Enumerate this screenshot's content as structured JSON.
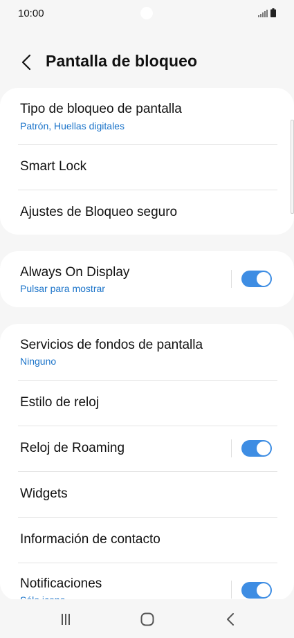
{
  "status_bar": {
    "time": "10:00"
  },
  "header": {
    "title": "Pantalla de bloqueo",
    "back_icon": "chevron-left-icon"
  },
  "group1": {
    "items": [
      {
        "title": "Tipo de bloqueo de pantalla",
        "subtitle": "Patrón, Huellas digitales"
      },
      {
        "title": "Smart Lock"
      },
      {
        "title": "Ajustes de Bloqueo seguro"
      }
    ]
  },
  "group2": {
    "items": [
      {
        "title": "Always On Display",
        "subtitle": "Pulsar para mostrar",
        "toggle": true
      }
    ]
  },
  "group3": {
    "items": [
      {
        "title": "Servicios de fondos de pantalla",
        "subtitle": "Ninguno"
      },
      {
        "title": "Estilo de reloj"
      },
      {
        "title": "Reloj de Roaming",
        "toggle": true
      },
      {
        "title": "Widgets"
      },
      {
        "title": "Información de contacto"
      },
      {
        "title": "Notificaciones",
        "subtitle": "Sólo icono",
        "toggle": true
      }
    ]
  },
  "nav": {
    "recents_icon": "recents-icon",
    "home_icon": "home-icon",
    "back_icon": "back-icon"
  },
  "colors": {
    "accent": "#3e8de3",
    "subtitle": "#1a73c9",
    "background": "#f6f6f6",
    "card": "#ffffff"
  }
}
